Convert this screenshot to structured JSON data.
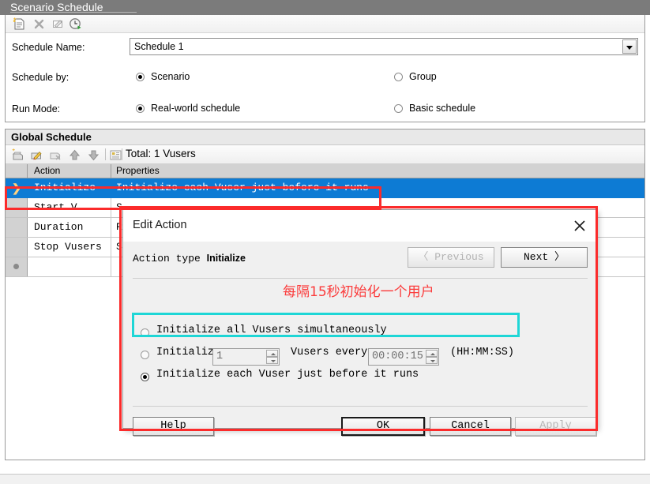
{
  "window": {
    "title": "Scenario Schedule"
  },
  "top_toolbar": {
    "icons": [
      {
        "name": "new-schedule-icon",
        "glyph": "☷"
      },
      {
        "name": "delete-schedule-icon",
        "glyph": "✕"
      },
      {
        "name": "rename-schedule-icon",
        "glyph": "✎"
      },
      {
        "name": "run-schedule-icon",
        "glyph": "◷"
      }
    ]
  },
  "schedule_form": {
    "name_label": "Schedule Name:",
    "name_value": "Schedule 1",
    "by_label": "Schedule by:",
    "by_options": [
      {
        "label": "Scenario",
        "selected": true
      },
      {
        "label": "Group",
        "selected": false
      }
    ],
    "run_mode_label": "Run Mode:",
    "run_mode_options": [
      {
        "label": "Real-world schedule",
        "selected": true
      },
      {
        "label": "Basic schedule",
        "selected": false
      }
    ]
  },
  "global_schedule": {
    "title": "Global Schedule",
    "total": "Total: 1 Vusers",
    "toolbar_icons": [
      {
        "name": "new-action-icon"
      },
      {
        "name": "edit-action-icon"
      },
      {
        "name": "delete-action-icon"
      },
      {
        "name": "move-up-icon"
      },
      {
        "name": "move-down-icon"
      },
      {
        "name": "grid-view-icon"
      }
    ],
    "columns": [
      "Action",
      "Properties"
    ],
    "rows": [
      {
        "arrow": "❯",
        "action": "Initialize",
        "properties": "Initialize each Vuser just before it runs",
        "selected": true
      },
      {
        "arrow": "",
        "action": "Start  V...",
        "properties": "S",
        "selected": false
      },
      {
        "arrow": "",
        "action": "Duration",
        "properties": "R",
        "selected": false
      },
      {
        "arrow": "",
        "action": "Stop Vusers",
        "properties": "S",
        "selected": false
      },
      {
        "arrow": "●",
        "action": "",
        "properties": "",
        "selected": false
      }
    ]
  },
  "dialog": {
    "title": "Edit Action",
    "close_icon": "close-icon",
    "action_type_prefix": "Action type ",
    "action_type_value": "Initialize",
    "previous_label": "〈  Previous",
    "next_label": "Next  〉",
    "options": [
      {
        "label": "Initialize all Vusers simultaneously",
        "selected": false
      },
      {
        "label": "Initializ",
        "selected": false
      },
      {
        "label": "Initialize each Vuser just before it runs",
        "selected": true
      }
    ],
    "vusers_count": "1",
    "every_prefix": "Vusers every",
    "every_value": "00:00:15",
    "time_format_hint": "(HH:MM:SS)",
    "buttons": {
      "help": "Help",
      "ok": "OK",
      "cancel": "Cancel",
      "apply": "Apply"
    }
  },
  "annotations": {
    "chinese_note": "每隔15秒初始化一个用户",
    "red_color": "#fb2b2b",
    "cyan_color": "#1ed6d6"
  }
}
